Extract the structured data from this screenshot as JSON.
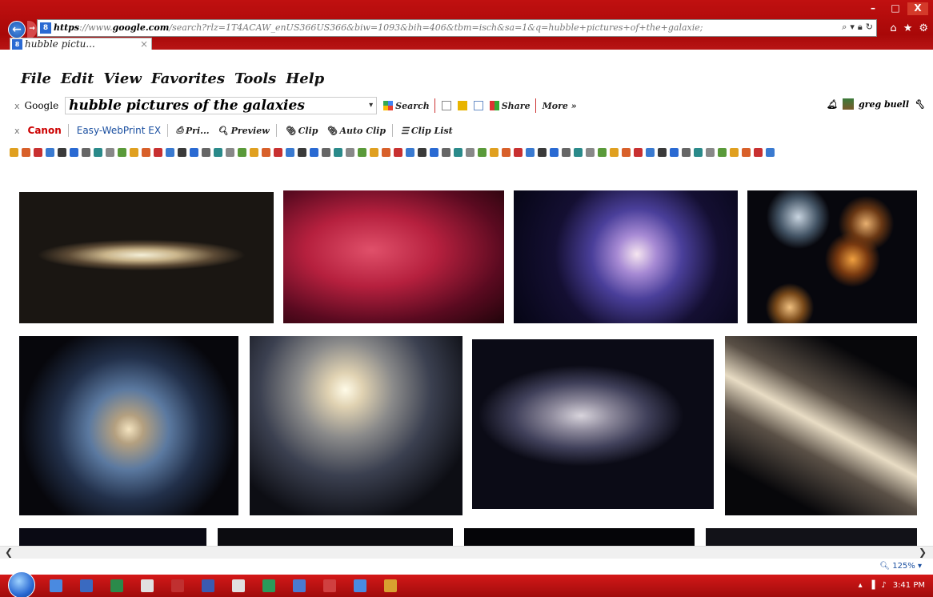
{
  "browser": {
    "url_prefix": "https",
    "url_scheme_sep": "://www.",
    "url_domain": "google.com",
    "url_rest": "/search?rlz=1T4ACAW_enUS366US366&biw=1093&bih=406&tbm=isch&sa=1&q=hubble+pictures+of+the+galaxie;",
    "tab_title": "hubble pictu...",
    "tab_close": "×",
    "back": "←",
    "forward": "→",
    "win_min": "–",
    "win_max": "□",
    "win_close": "X"
  },
  "menu": {
    "items": [
      "File",
      "Edit",
      "View",
      "Favorites",
      "Tools",
      "Help"
    ]
  },
  "google_toolbar": {
    "close": "x",
    "logo": "Google",
    "query": "hubble pictures of the galaxies",
    "search_label": "Search",
    "share_label": "Share",
    "more_label": "More »",
    "user_name": "greg buell"
  },
  "canon_toolbar": {
    "close": "x",
    "brand": "Canon",
    "app": "Easy-WebPrint EX",
    "print_label": "Pri...",
    "preview_label": "Preview",
    "clip_label": "Clip",
    "auto_clip_label": "Auto Clip",
    "clip_list_label": "Clip List"
  },
  "status": {
    "zoom": "125%"
  },
  "taskbar": {
    "time": "3:41 PM"
  },
  "colors": {
    "chrome_red": "#b00c0c",
    "accent_blue": "#2a6ad3"
  },
  "icons": [
    "back-arrow-icon",
    "forward-arrow-icon",
    "search-icon",
    "lock-icon",
    "refresh-icon",
    "home-icon",
    "star-icon",
    "gear-icon",
    "bell-icon",
    "wrench-icon"
  ]
}
